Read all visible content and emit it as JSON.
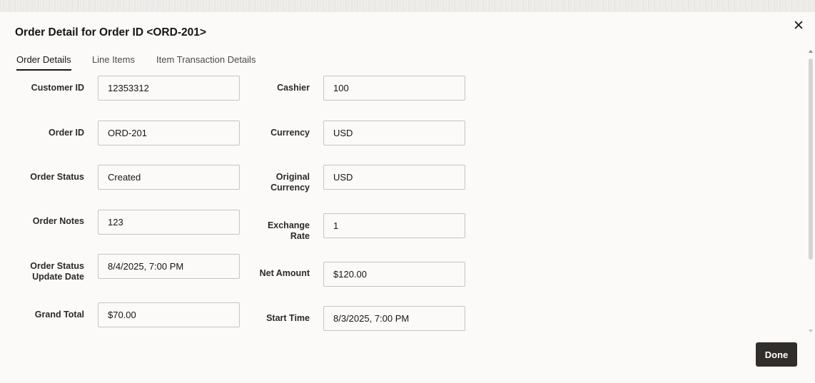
{
  "dialog": {
    "title": "Order Detail for Order ID <ORD-201>",
    "close_icon": "close-icon"
  },
  "tabs": [
    {
      "label": "Order Details",
      "active": true
    },
    {
      "label": "Line Items",
      "active": false
    },
    {
      "label": "Item Transaction Details",
      "active": false
    }
  ],
  "left_fields": [
    {
      "label": "Customer ID",
      "value": "12353312"
    },
    {
      "label": "Order ID",
      "value": "ORD-201"
    },
    {
      "label": "Order Status",
      "value": "Created"
    },
    {
      "label": "Order Notes",
      "value": "123"
    },
    {
      "label_line1": "Order Status",
      "label_line2": "Update Date",
      "value": "8/4/2025, 7:00 PM"
    },
    {
      "label": "Grand Total",
      "value": "$70.00"
    }
  ],
  "right_fields": [
    {
      "label": "Cashier",
      "value": "100"
    },
    {
      "label": "Currency",
      "value": "USD"
    },
    {
      "label_line1": "Original",
      "label_line2": "Currency",
      "value": "USD"
    },
    {
      "label_line1": "Exchange",
      "label_line2": "Rate",
      "value": "1"
    },
    {
      "label": "Net Amount",
      "value": "$120.00"
    },
    {
      "label": "Start Time",
      "value": "8/3/2025, 7:00 PM"
    }
  ],
  "footer": {
    "done_label": "Done"
  },
  "colors": {
    "background": "#fbfaf8",
    "primary_button": "#312d2a",
    "field_border": "#c8c5c0",
    "text": "#161513"
  }
}
